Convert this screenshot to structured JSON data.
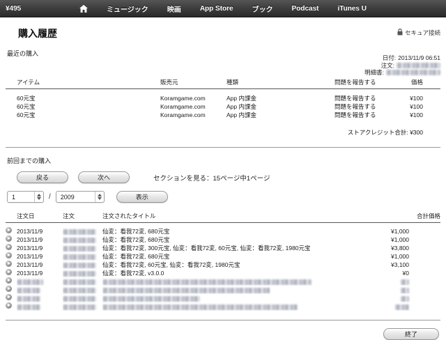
{
  "topnav": {
    "balance": "¥495",
    "items": [
      "ミュージック",
      "映画",
      "App Store",
      "ブック",
      "Podcast",
      "iTunes U"
    ]
  },
  "header": {
    "title": "購入履歴",
    "secure_label": "セキュア接続"
  },
  "recent": {
    "section_label": "最近の購入",
    "meta": {
      "date_label": "日付:",
      "date_value": "2013/11/9 06:51",
      "order_label": "注文:",
      "invoice_label": "明細書:"
    },
    "table": {
      "headers": [
        "アイテム",
        "販売元",
        "種類",
        "問題を報告する",
        "価格"
      ],
      "rows": [
        {
          "item": "60元宝",
          "seller": "Koramgame.com",
          "type": "App 内課金",
          "report": "問題を報告する",
          "price": "¥100"
        },
        {
          "item": "60元宝",
          "seller": "Koramgame.com",
          "type": "App 内課金",
          "report": "問題を報告する",
          "price": "¥100"
        },
        {
          "item": "60元宝",
          "seller": "Koramgame.com",
          "type": "App 内課金",
          "report": "問題を報告する",
          "price": "¥100"
        }
      ],
      "credit_total": "ストアクレジット合計: ¥300"
    }
  },
  "previous": {
    "section_label": "前回までの購入",
    "back_button": "戻る",
    "next_button": "次へ",
    "section_info": "セクションを見る：15ページ中1ページ",
    "page_select_value": "1",
    "separator": "/",
    "year_select_value": "2009",
    "show_button": "表示",
    "table": {
      "headers": [
        "注文日",
        "注文",
        "注文されたタイトル",
        "合計価格"
      ],
      "rows": [
        {
          "date": "2013/11/9",
          "title": "仙変：看我72変, 680元宝",
          "total": "¥1,000"
        },
        {
          "date": "2013/11/9",
          "title": "仙変：看我72変, 680元宝",
          "total": "¥1,000"
        },
        {
          "date": "2013/11/9",
          "title": "仙変：看我72変, 300元宝, 仙変：看我72変, 60元宝, 仙変：看我72変, 1980元宝",
          "total": "¥3,800"
        },
        {
          "date": "2013/11/9",
          "title": "仙変：看我72変, 680元宝",
          "total": "¥1,000"
        },
        {
          "date": "2013/11/9",
          "title": "仙変：看我72変, 60元宝, 仙変：看我72変, 1980元宝",
          "total": "¥3,100"
        },
        {
          "date": "2013/11/9",
          "title": "仙変：看我72変, v3.0.0",
          "total": "¥0"
        }
      ],
      "redacted_row_count": 4
    }
  },
  "footer": {
    "done_button": "終了"
  },
  "icons": {
    "home": "home-icon",
    "lock": "lock-icon",
    "row_arrow": "order-detail-arrow-icon",
    "stepper": "select-stepper-arrows"
  },
  "colors": {
    "navbar_top": "#555555",
    "navbar_bottom": "#2a2a2a",
    "nav_text": "#ffffff",
    "body_bg": "#ffffff",
    "text": "#1a1a1a",
    "rule_dark": "#555555",
    "rule_light": "#999999"
  }
}
